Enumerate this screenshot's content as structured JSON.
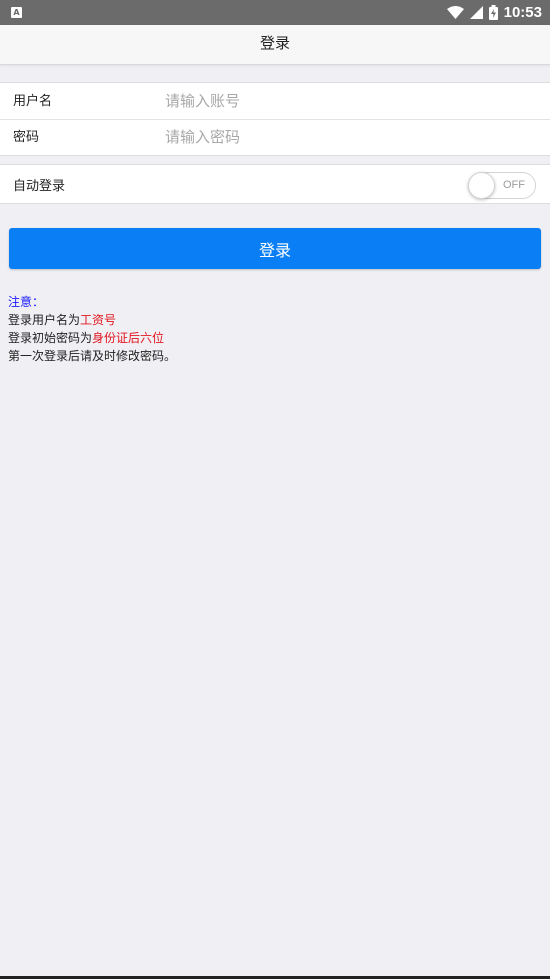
{
  "status_bar": {
    "time": "10:53",
    "notification_icon": "a-notification-icon",
    "wifi_icon": "wifi-icon",
    "signal_icon": "cell-signal-icon",
    "battery_icon": "battery-charging-icon"
  },
  "navbar": {
    "title": "登录"
  },
  "form": {
    "username": {
      "label": "用户名",
      "placeholder": "请输入账号",
      "value": ""
    },
    "password": {
      "label": "密码",
      "placeholder": "请输入密码",
      "value": ""
    }
  },
  "auto_login": {
    "label": "自动登录",
    "state_text": "OFF",
    "enabled": false
  },
  "login_button": {
    "label": "登录",
    "color": "#0a7ff5"
  },
  "notice": {
    "heading": "注意：",
    "line1_prefix": "登录用户名为",
    "line1_highlight": "工资号",
    "line2_prefix": "登录初始密码为",
    "line2_highlight": "身份证后六位",
    "line3": "第一次登录后请及时修改密码。",
    "heading_color": "#1a1aff",
    "highlight_color": "#e3151d"
  }
}
